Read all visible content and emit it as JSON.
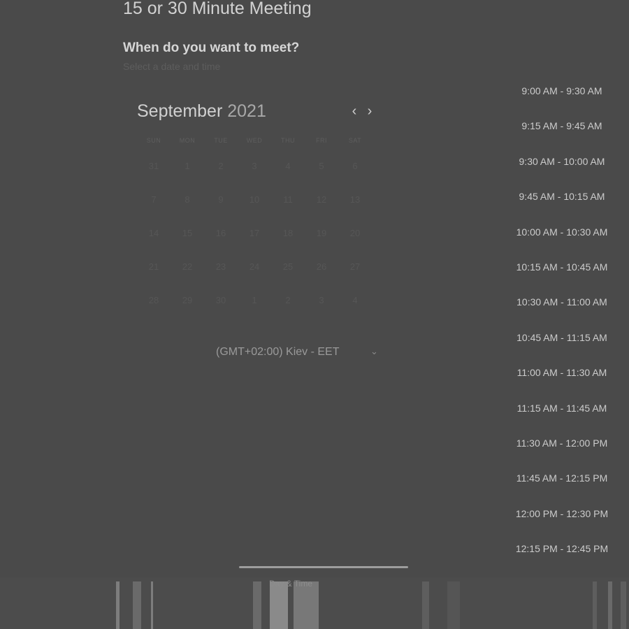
{
  "page": {
    "title": "15 or 30 Minute Meeting",
    "subheading": "When do you want to meet?",
    "hint": "Select a date and time"
  },
  "calendar": {
    "month": "September",
    "year": "2021",
    "prev_icon": "chevron-left-icon",
    "next_icon": "chevron-right-icon",
    "weekdays": [
      "SUN",
      "MON",
      "TUE",
      "WED",
      "THU",
      "FRI",
      "SAT"
    ],
    "weeks": [
      [
        "31",
        "1",
        "2",
        "3",
        "4",
        "5",
        "6"
      ],
      [
        "7",
        "8",
        "9",
        "10",
        "11",
        "12",
        "13"
      ],
      [
        "14",
        "15",
        "16",
        "17",
        "18",
        "19",
        "20"
      ],
      [
        "21",
        "22",
        "23",
        "24",
        "25",
        "26",
        "27"
      ],
      [
        "28",
        "29",
        "30",
        "1",
        "2",
        "3",
        "4"
      ]
    ]
  },
  "timezone": {
    "label": "(GMT+02:00) Kiev - EET",
    "chevron_icon": "chevron-down-icon"
  },
  "time_slots": [
    "9:00 AM - 9:30 AM",
    "9:15 AM - 9:45 AM",
    "9:30 AM - 10:00 AM",
    "9:45 AM - 10:15 AM",
    "10:00 AM - 10:30 AM",
    "10:15 AM - 10:45 AM",
    "10:30 AM - 11:00 AM",
    "10:45 AM - 11:15 AM",
    "11:00 AM - 11:30 AM",
    "11:15 AM - 11:45 AM",
    "11:30 AM - 12:00 PM",
    "11:45 AM - 12:15 PM",
    "12:00 PM - 12:30 PM",
    "12:15 PM - 12:45 PM"
  ],
  "bottom_nav": {
    "label": "Day & Time"
  },
  "colors": {
    "background": "#4a4a4a",
    "text": "#cfcfcf",
    "muted": "#5d5d5d",
    "scroll_indicator": "#9d9d9d"
  }
}
